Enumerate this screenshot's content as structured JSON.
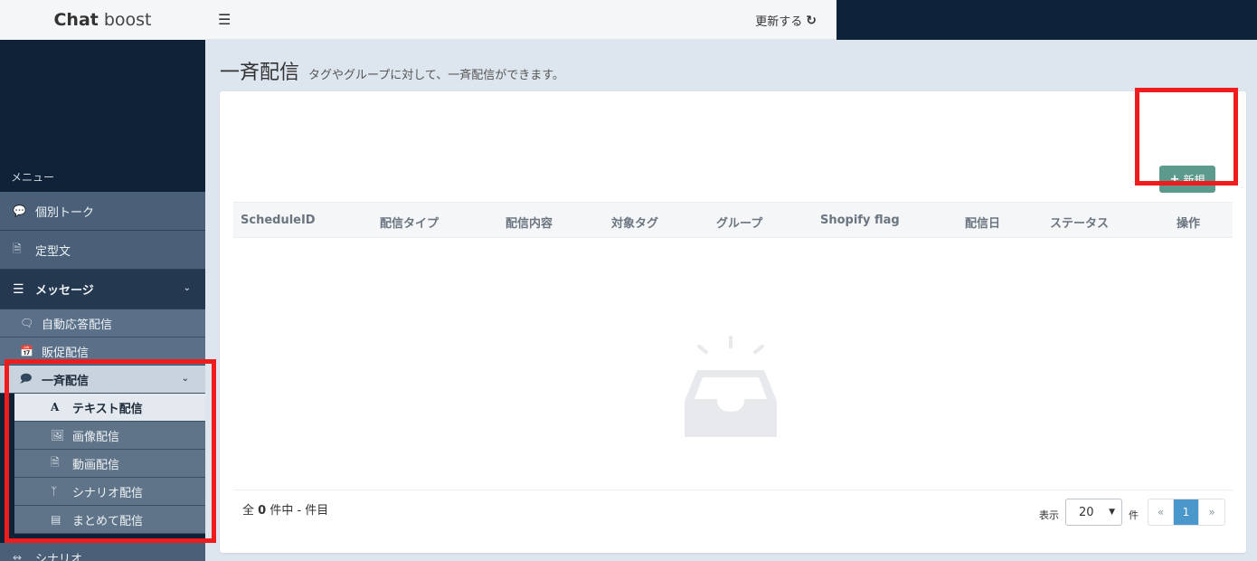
{
  "brand": {
    "bold": "Chat",
    "light": "boost"
  },
  "topbar": {
    "refresh_label": "更新する",
    "refresh_icon": "refresh-icon",
    "menu_icon": "hamburger-icon"
  },
  "sidebar": {
    "menu_label": "メニュー",
    "items": [
      {
        "label": "個別トーク",
        "icon": "speech-bubble-icon"
      },
      {
        "label": "定型文",
        "icon": "document-icon"
      },
      {
        "label": "メッセージ",
        "icon": "list-icon"
      }
    ],
    "message_sub": [
      {
        "label": "自動応答配信",
        "icon": "chat-bubble-icon"
      },
      {
        "label": "販促配信",
        "icon": "calendar-icon"
      },
      {
        "label": "一斉配信",
        "icon": "comments-icon"
      }
    ],
    "broadcast_sub": [
      {
        "label": "テキスト配信",
        "icon": "text-icon"
      },
      {
        "label": "画像配信",
        "icon": "image-icon"
      },
      {
        "label": "動画配信",
        "icon": "video-file-icon"
      },
      {
        "label": "シナリオ配信",
        "icon": "branch-icon"
      },
      {
        "label": "まとめて配信",
        "icon": "stack-icon"
      }
    ],
    "bottom_item": {
      "label": "シナリオ",
      "icon": "usb-icon"
    }
  },
  "main": {
    "title": "一斉配信",
    "subtitle": "タグやグループに対して、一斉配信ができます。",
    "new_button": "新規",
    "columns": [
      "ScheduleID",
      "配信タイプ",
      "配信内容",
      "対象タグ",
      "グループ",
      "Shopify flag",
      "配信日",
      "ステータス",
      "操作"
    ],
    "total_prefix": "全",
    "total_count": "0",
    "total_suffix": "件中 - 件目",
    "show_label": "表示",
    "page_size": "20",
    "page_unit": "件",
    "pagination": {
      "prev": "«",
      "current": "1",
      "next": "»"
    }
  },
  "colors": {
    "accent_button": "#5c9a8d",
    "active_page": "#4a97cc",
    "highlight": "#ee1c1c",
    "sidebar_dark": "#0f2238"
  }
}
